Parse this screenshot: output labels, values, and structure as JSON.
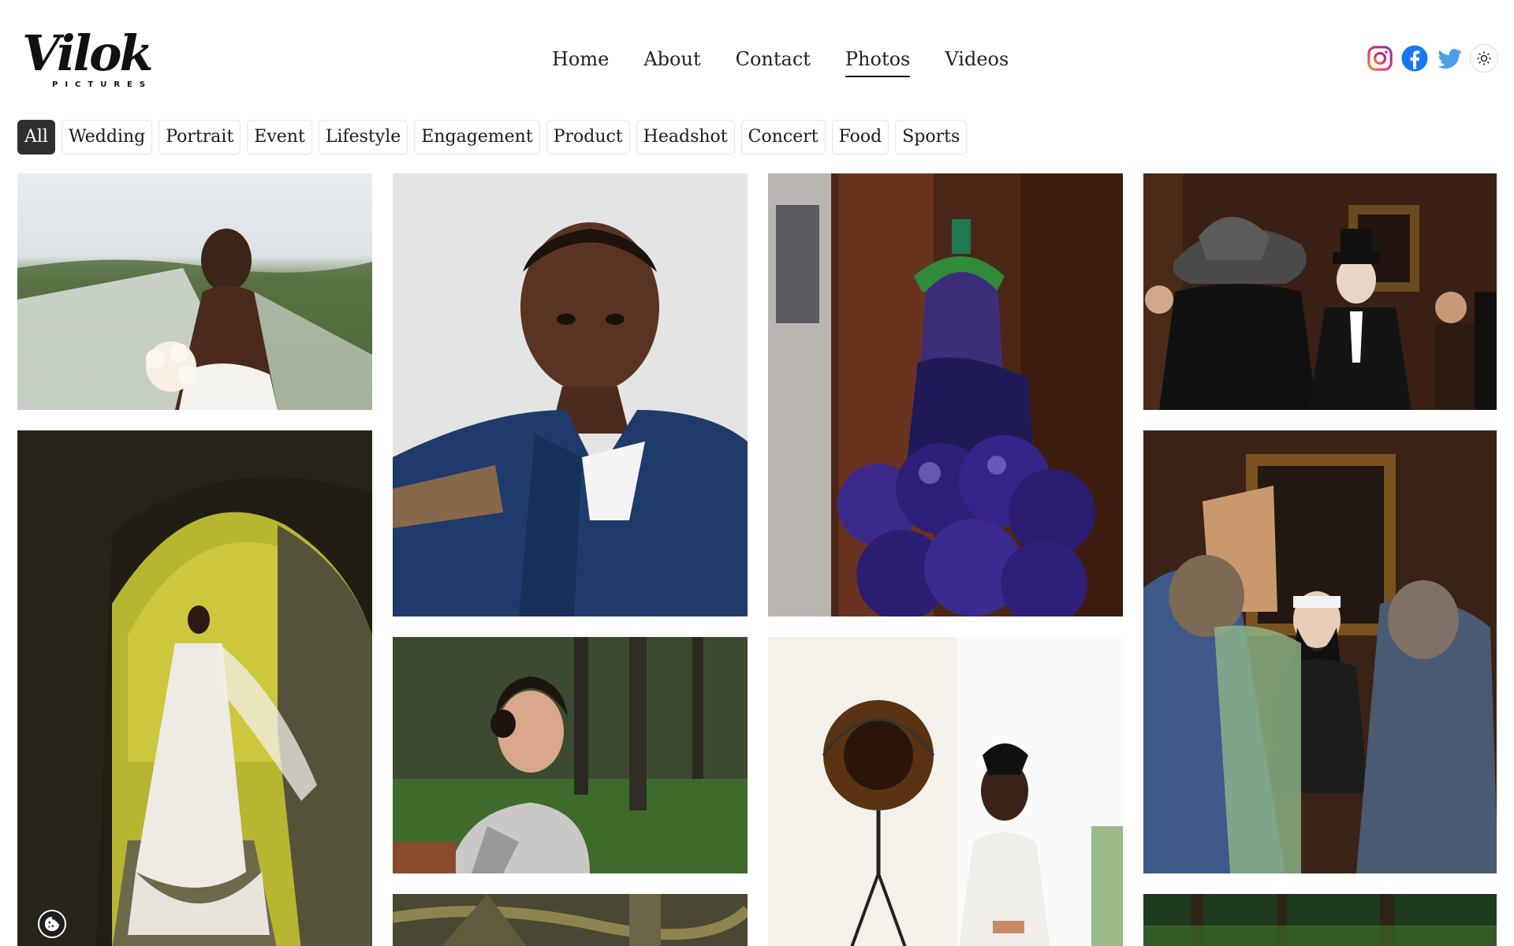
{
  "brand": {
    "logo_script": "Vilok",
    "logo_sub": "PICTURES"
  },
  "nav": {
    "items": [
      {
        "label": "Home"
      },
      {
        "label": "About"
      },
      {
        "label": "Contact"
      },
      {
        "label": "Photos",
        "active": true
      },
      {
        "label": "Videos"
      }
    ]
  },
  "social": {
    "icons": [
      "instagram-icon",
      "facebook-icon",
      "twitter-icon",
      "sun-icon"
    ],
    "colors": {
      "instagram": "#e1306c",
      "facebook": "#1877f2",
      "twitter": "#1da1f2"
    }
  },
  "filters": {
    "items": [
      {
        "label": "All",
        "active": true
      },
      {
        "label": "Wedding"
      },
      {
        "label": "Portrait"
      },
      {
        "label": "Event"
      },
      {
        "label": "Lifestyle"
      },
      {
        "label": "Engagement"
      },
      {
        "label": "Product"
      },
      {
        "label": "Headshot"
      },
      {
        "label": "Concert"
      },
      {
        "label": "Food"
      },
      {
        "label": "Sports"
      }
    ]
  },
  "gallery": {
    "photos": [
      {
        "name": "photo-bride-veil-hilltop",
        "subject": "bride with veil and bouquet on hilltop"
      },
      {
        "name": "photo-boy-portrait",
        "subject": "boy in navy jacket portrait"
      },
      {
        "name": "photo-grape-costume",
        "subject": "woman in grape costume at party"
      },
      {
        "name": "photo-party-cowboy-hat",
        "subject": "costume party guests with cowboy hat and top hat"
      },
      {
        "name": "photo-bride-stone-arch",
        "subject": "bride under stone arch"
      },
      {
        "name": "photo-woman-qipao",
        "subject": "woman in qipao in park"
      },
      {
        "name": "photo-fashion-lamp",
        "subject": "fashion model next to studio lamp"
      },
      {
        "name": "photo-party-bearded-mask",
        "subject": "party guests, man with fake beard"
      },
      {
        "name": "photo-forest-branches",
        "subject": "forest branches"
      },
      {
        "name": "photo-forest-green",
        "subject": "green forest"
      }
    ]
  },
  "cookie": {
    "icon": "cookie-icon"
  }
}
